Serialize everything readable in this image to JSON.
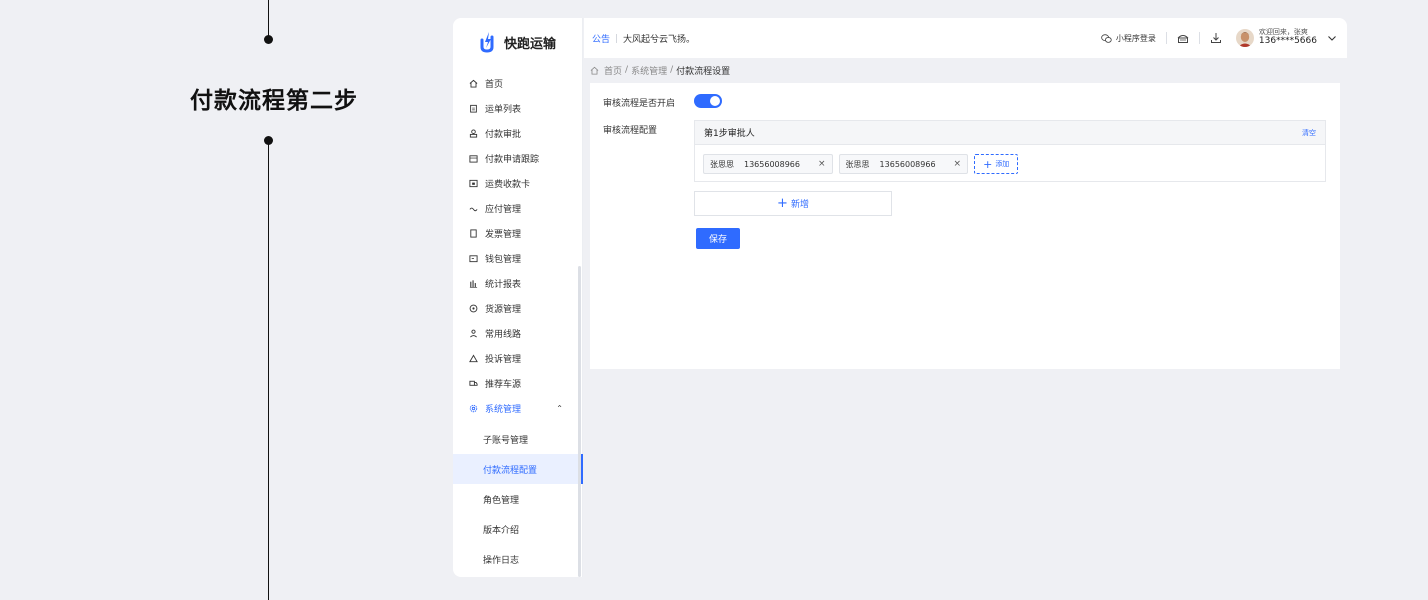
{
  "annotation": {
    "step_title": "付款流程第二步"
  },
  "app": {
    "name": "快跑运输"
  },
  "sidebar": {
    "items": [
      {
        "label": "首页",
        "icon": "home-icon"
      },
      {
        "label": "运单列表",
        "icon": "clipboard-icon"
      },
      {
        "label": "付款审批",
        "icon": "stamp-icon"
      },
      {
        "label": "付款申请跟踪",
        "icon": "calendar-icon"
      },
      {
        "label": "运费收款卡",
        "icon": "card-icon"
      },
      {
        "label": "应付管理",
        "icon": "wallet-icon"
      },
      {
        "label": "发票管理",
        "icon": "invoice-icon"
      },
      {
        "label": "钱包管理",
        "icon": "purse-icon"
      },
      {
        "label": "统计报表",
        "icon": "bar-chart-icon"
      },
      {
        "label": "货源管理",
        "icon": "cargo-icon"
      },
      {
        "label": "常用线路",
        "icon": "route-icon"
      },
      {
        "label": "投诉管理",
        "icon": "complaint-icon"
      },
      {
        "label": "推荐车源",
        "icon": "truck-icon"
      },
      {
        "label": "系统管理",
        "icon": "settings-icon"
      }
    ],
    "subitems": [
      "子账号管理",
      "付款流程配置",
      "角色管理",
      "版本介绍",
      "操作日志"
    ],
    "active_sub": "付款流程配置"
  },
  "header": {
    "notice_tag": "公告",
    "notice_text": "大风起兮云飞扬。",
    "mini_program": "小程序登录",
    "welcome": "欢迎回来，张爽",
    "phone": "136****5666"
  },
  "breadcrumb": {
    "home": "首页",
    "parent": "系统管理",
    "current": "付款流程设置",
    "sep": "/"
  },
  "form": {
    "switch_label": "审核流程是否开启",
    "switch_on": true,
    "config_label": "审核流程配置",
    "step_title": "第1步审批人",
    "clear_label": "清空",
    "approvers": [
      {
        "name": "张思思",
        "phone": "13656008966"
      },
      {
        "name": "张思思",
        "phone": "13656008966"
      }
    ],
    "remove_symbol": "×",
    "add_label": "添加",
    "new_label": "新增",
    "save_label": "保存"
  },
  "colors": {
    "accent": "#2f6bff",
    "background": "#eff0f4"
  }
}
